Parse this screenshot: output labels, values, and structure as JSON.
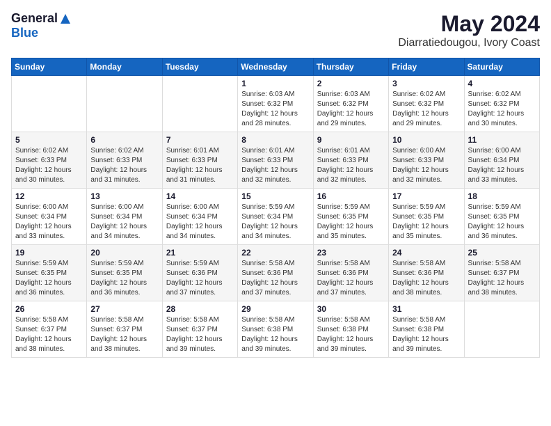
{
  "header": {
    "logo_general": "General",
    "logo_blue": "Blue",
    "month_year": "May 2024",
    "location": "Diarratiedougou, Ivory Coast"
  },
  "days_of_week": [
    "Sunday",
    "Monday",
    "Tuesday",
    "Wednesday",
    "Thursday",
    "Friday",
    "Saturday"
  ],
  "weeks": [
    [
      {
        "day": "",
        "info": ""
      },
      {
        "day": "",
        "info": ""
      },
      {
        "day": "",
        "info": ""
      },
      {
        "day": "1",
        "info": "Sunrise: 6:03 AM\nSunset: 6:32 PM\nDaylight: 12 hours\nand 28 minutes."
      },
      {
        "day": "2",
        "info": "Sunrise: 6:03 AM\nSunset: 6:32 PM\nDaylight: 12 hours\nand 29 minutes."
      },
      {
        "day": "3",
        "info": "Sunrise: 6:02 AM\nSunset: 6:32 PM\nDaylight: 12 hours\nand 29 minutes."
      },
      {
        "day": "4",
        "info": "Sunrise: 6:02 AM\nSunset: 6:32 PM\nDaylight: 12 hours\nand 30 minutes."
      }
    ],
    [
      {
        "day": "5",
        "info": "Sunrise: 6:02 AM\nSunset: 6:33 PM\nDaylight: 12 hours\nand 30 minutes."
      },
      {
        "day": "6",
        "info": "Sunrise: 6:02 AM\nSunset: 6:33 PM\nDaylight: 12 hours\nand 31 minutes."
      },
      {
        "day": "7",
        "info": "Sunrise: 6:01 AM\nSunset: 6:33 PM\nDaylight: 12 hours\nand 31 minutes."
      },
      {
        "day": "8",
        "info": "Sunrise: 6:01 AM\nSunset: 6:33 PM\nDaylight: 12 hours\nand 32 minutes."
      },
      {
        "day": "9",
        "info": "Sunrise: 6:01 AM\nSunset: 6:33 PM\nDaylight: 12 hours\nand 32 minutes."
      },
      {
        "day": "10",
        "info": "Sunrise: 6:00 AM\nSunset: 6:33 PM\nDaylight: 12 hours\nand 32 minutes."
      },
      {
        "day": "11",
        "info": "Sunrise: 6:00 AM\nSunset: 6:34 PM\nDaylight: 12 hours\nand 33 minutes."
      }
    ],
    [
      {
        "day": "12",
        "info": "Sunrise: 6:00 AM\nSunset: 6:34 PM\nDaylight: 12 hours\nand 33 minutes."
      },
      {
        "day": "13",
        "info": "Sunrise: 6:00 AM\nSunset: 6:34 PM\nDaylight: 12 hours\nand 34 minutes."
      },
      {
        "day": "14",
        "info": "Sunrise: 6:00 AM\nSunset: 6:34 PM\nDaylight: 12 hours\nand 34 minutes."
      },
      {
        "day": "15",
        "info": "Sunrise: 5:59 AM\nSunset: 6:34 PM\nDaylight: 12 hours\nand 34 minutes."
      },
      {
        "day": "16",
        "info": "Sunrise: 5:59 AM\nSunset: 6:35 PM\nDaylight: 12 hours\nand 35 minutes."
      },
      {
        "day": "17",
        "info": "Sunrise: 5:59 AM\nSunset: 6:35 PM\nDaylight: 12 hours\nand 35 minutes."
      },
      {
        "day": "18",
        "info": "Sunrise: 5:59 AM\nSunset: 6:35 PM\nDaylight: 12 hours\nand 36 minutes."
      }
    ],
    [
      {
        "day": "19",
        "info": "Sunrise: 5:59 AM\nSunset: 6:35 PM\nDaylight: 12 hours\nand 36 minutes."
      },
      {
        "day": "20",
        "info": "Sunrise: 5:59 AM\nSunset: 6:35 PM\nDaylight: 12 hours\nand 36 minutes."
      },
      {
        "day": "21",
        "info": "Sunrise: 5:59 AM\nSunset: 6:36 PM\nDaylight: 12 hours\nand 37 minutes."
      },
      {
        "day": "22",
        "info": "Sunrise: 5:58 AM\nSunset: 6:36 PM\nDaylight: 12 hours\nand 37 minutes."
      },
      {
        "day": "23",
        "info": "Sunrise: 5:58 AM\nSunset: 6:36 PM\nDaylight: 12 hours\nand 37 minutes."
      },
      {
        "day": "24",
        "info": "Sunrise: 5:58 AM\nSunset: 6:36 PM\nDaylight: 12 hours\nand 38 minutes."
      },
      {
        "day": "25",
        "info": "Sunrise: 5:58 AM\nSunset: 6:37 PM\nDaylight: 12 hours\nand 38 minutes."
      }
    ],
    [
      {
        "day": "26",
        "info": "Sunrise: 5:58 AM\nSunset: 6:37 PM\nDaylight: 12 hours\nand 38 minutes."
      },
      {
        "day": "27",
        "info": "Sunrise: 5:58 AM\nSunset: 6:37 PM\nDaylight: 12 hours\nand 38 minutes."
      },
      {
        "day": "28",
        "info": "Sunrise: 5:58 AM\nSunset: 6:37 PM\nDaylight: 12 hours\nand 39 minutes."
      },
      {
        "day": "29",
        "info": "Sunrise: 5:58 AM\nSunset: 6:38 PM\nDaylight: 12 hours\nand 39 minutes."
      },
      {
        "day": "30",
        "info": "Sunrise: 5:58 AM\nSunset: 6:38 PM\nDaylight: 12 hours\nand 39 minutes."
      },
      {
        "day": "31",
        "info": "Sunrise: 5:58 AM\nSunset: 6:38 PM\nDaylight: 12 hours\nand 39 minutes."
      },
      {
        "day": "",
        "info": ""
      }
    ]
  ]
}
